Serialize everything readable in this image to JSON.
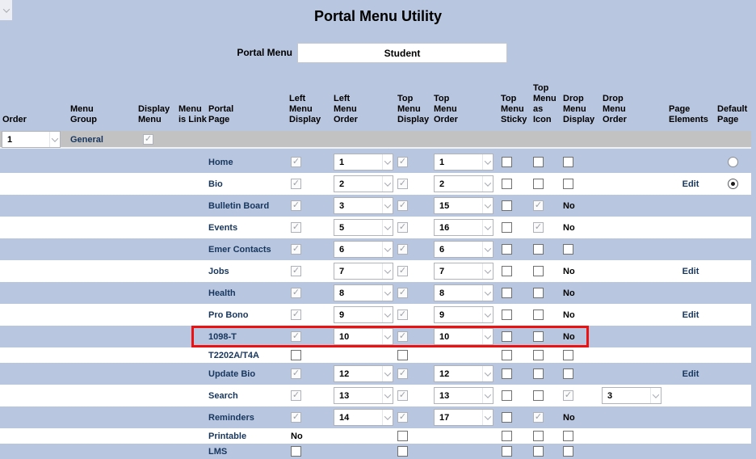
{
  "title": "Portal Menu Utility",
  "portal_menu": {
    "label": "Portal Menu",
    "value": "Student"
  },
  "colors": {
    "background": "#b8c6df",
    "row_blue": "#b8c6df",
    "row_white": "#ffffff",
    "group_row_gray": "#c2c2c2",
    "link_navy": "#17365d",
    "highlight_red": "#ee1111"
  },
  "table": {
    "headers": [
      "Order",
      "Menu Group",
      "Display Menu",
      "Menu is Link",
      "Portal Page",
      "Left Menu Display",
      "Left Menu Order",
      "Top Menu Display",
      "Top Menu Order",
      "Top Menu Sticky",
      "Top Menu as Icon",
      "Drop Menu Display",
      "Drop Menu Order",
      "Page Elements",
      "Default Page"
    ],
    "no_label": "No",
    "edit_label": "Edit",
    "group_row": {
      "order": "1",
      "menu_group": "General",
      "display_menu": "checked"
    },
    "rows": [
      {
        "page": "Home",
        "left_display": "checked",
        "left_order": "1",
        "top_display": "checked",
        "top_order": "1",
        "top_sticky": "unchecked",
        "top_icon": "unchecked",
        "drop_display": "unchecked",
        "drop_order": null,
        "page_elements": null,
        "default_page": "radio",
        "highlight": false
      },
      {
        "page": "Bio",
        "left_display": "checked",
        "left_order": "2",
        "top_display": "checked",
        "top_order": "2",
        "top_sticky": "unchecked",
        "top_icon": "unchecked",
        "drop_display": "unchecked",
        "drop_order": null,
        "page_elements": "Edit",
        "default_page": "radio-selected",
        "highlight": false
      },
      {
        "page": "Bulletin Board",
        "left_display": "checked",
        "left_order": "3",
        "top_display": "checked",
        "top_order": "15",
        "top_sticky": "unchecked",
        "top_icon": "checked",
        "drop_display": "no",
        "drop_order": null,
        "page_elements": null,
        "default_page": null,
        "highlight": false
      },
      {
        "page": "Events",
        "left_display": "checked",
        "left_order": "5",
        "top_display": "checked",
        "top_order": "16",
        "top_sticky": "unchecked",
        "top_icon": "checked",
        "drop_display": "no",
        "drop_order": null,
        "page_elements": null,
        "default_page": null,
        "highlight": false
      },
      {
        "page": "Emer Contacts",
        "left_display": "checked",
        "left_order": "6",
        "top_display": "checked",
        "top_order": "6",
        "top_sticky": "unchecked",
        "top_icon": "unchecked",
        "drop_display": "unchecked",
        "drop_order": null,
        "page_elements": null,
        "default_page": null,
        "highlight": false
      },
      {
        "page": "Jobs",
        "left_display": "checked",
        "left_order": "7",
        "top_display": "checked",
        "top_order": "7",
        "top_sticky": "unchecked",
        "top_icon": "unchecked",
        "drop_display": "no",
        "drop_order": null,
        "page_elements": "Edit",
        "default_page": null,
        "highlight": false
      },
      {
        "page": "Health",
        "left_display": "checked",
        "left_order": "8",
        "top_display": "checked",
        "top_order": "8",
        "top_sticky": "unchecked",
        "top_icon": "unchecked",
        "drop_display": "no",
        "drop_order": null,
        "page_elements": null,
        "default_page": null,
        "highlight": false
      },
      {
        "page": "Pro Bono",
        "left_display": "checked",
        "left_order": "9",
        "top_display": "checked",
        "top_order": "9",
        "top_sticky": "unchecked",
        "top_icon": "unchecked",
        "drop_display": "no",
        "drop_order": null,
        "page_elements": "Edit",
        "default_page": null,
        "highlight": false
      },
      {
        "page": "1098-T",
        "left_display": "checked",
        "left_order": "10",
        "top_display": "checked",
        "top_order": "10",
        "top_sticky": "unchecked",
        "top_icon": "unchecked",
        "drop_display": "no",
        "drop_order": null,
        "page_elements": null,
        "default_page": null,
        "highlight": true
      },
      {
        "page": "T2202A/T4A",
        "left_display": "unchecked",
        "left_order": null,
        "top_display": "unchecked",
        "top_order": null,
        "top_sticky": "unchecked",
        "top_icon": "unchecked",
        "drop_display": "unchecked",
        "drop_order": null,
        "page_elements": null,
        "default_page": null,
        "highlight": false
      },
      {
        "page": "Update Bio",
        "left_display": "checked",
        "left_order": "12",
        "top_display": "checked",
        "top_order": "12",
        "top_sticky": "unchecked",
        "top_icon": "unchecked",
        "drop_display": "unchecked",
        "drop_order": null,
        "page_elements": "Edit",
        "default_page": null,
        "highlight": false
      },
      {
        "page": "Search",
        "left_display": "checked",
        "left_order": "13",
        "top_display": "checked",
        "top_order": "13",
        "top_sticky": "unchecked",
        "top_icon": "unchecked",
        "drop_display": "checked",
        "drop_order": "3",
        "page_elements": null,
        "default_page": null,
        "highlight": false
      },
      {
        "page": "Reminders",
        "left_display": "checked",
        "left_order": "14",
        "top_display": "checked",
        "top_order": "17",
        "top_sticky": "unchecked",
        "top_icon": "checked",
        "drop_display": "no",
        "drop_order": null,
        "page_elements": null,
        "default_page": null,
        "highlight": false
      },
      {
        "page": "Printable",
        "left_display": "no",
        "left_order": null,
        "top_display": "unchecked",
        "top_order": null,
        "top_sticky": "unchecked",
        "top_icon": "unchecked",
        "drop_display": "unchecked",
        "drop_order": null,
        "page_elements": null,
        "default_page": null,
        "highlight": false
      },
      {
        "page": "LMS",
        "left_display": "unchecked",
        "left_order": null,
        "top_display": "unchecked",
        "top_order": null,
        "top_sticky": "unchecked",
        "top_icon": "unchecked",
        "drop_display": "unchecked",
        "drop_order": null,
        "page_elements": null,
        "default_page": null,
        "highlight": false
      }
    ]
  }
}
